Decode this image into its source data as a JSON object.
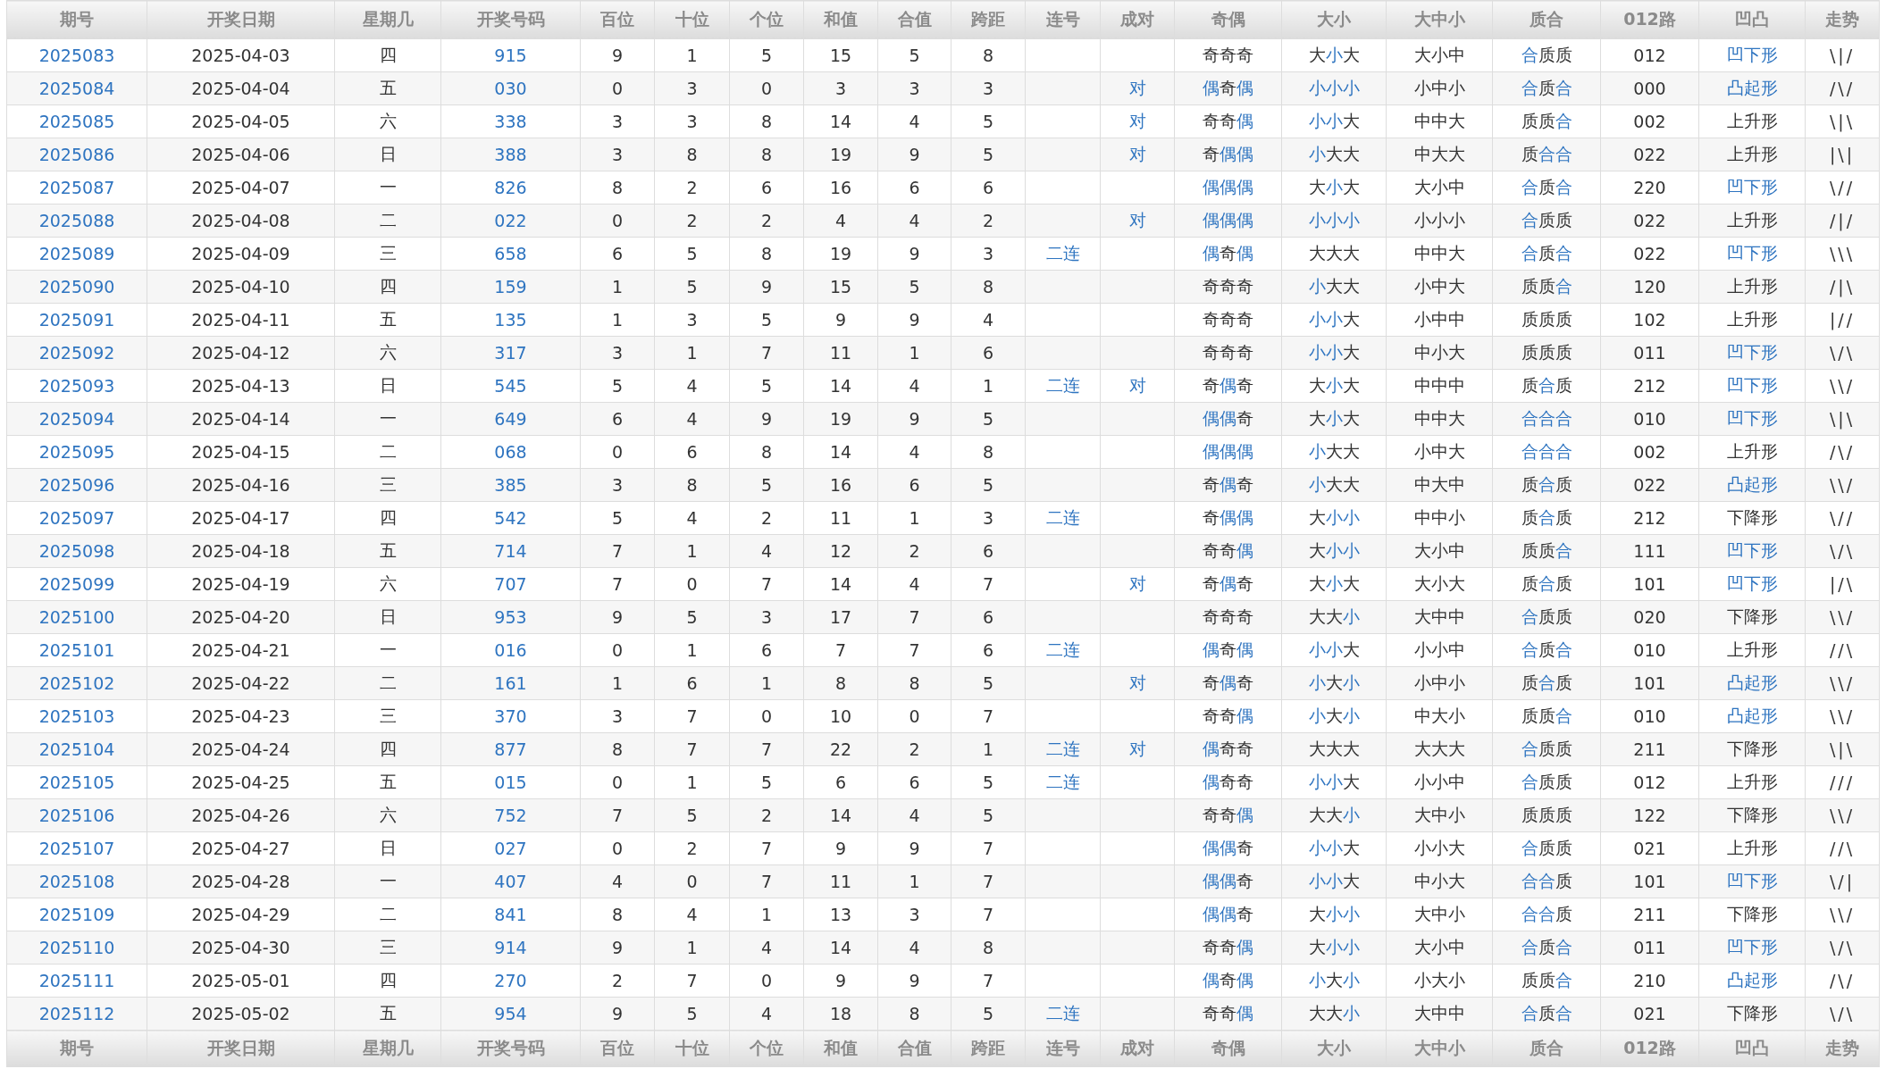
{
  "table": {
    "columns": [
      "期号",
      "开奖日期",
      "星期几",
      "开奖号码",
      "百位",
      "十位",
      "个位",
      "和值",
      "合值",
      "跨距",
      "连号",
      "成对",
      "奇偶",
      "大小",
      "大中小",
      "质合",
      "012路",
      "凹凸",
      "走势"
    ],
    "rows": [
      {
        "period": "2025083",
        "date": "2025-04-03",
        "weekday": "四",
        "number": "915",
        "hundreds": "9",
        "tens": "1",
        "units": "5",
        "sum": "15",
        "sum_tail": "5",
        "span": "8",
        "odd_even": [
          [
            "奇",
            false
          ],
          [
            "奇",
            false
          ],
          [
            "奇",
            false
          ]
        ],
        "big_small": [
          [
            "大",
            false
          ],
          [
            "小",
            true
          ],
          [
            "大",
            false
          ]
        ],
        "big_mid_small": "大小中",
        "prime_composite": [
          [
            "合",
            true
          ],
          [
            "质",
            false
          ],
          [
            "质",
            false
          ]
        ],
        "route_012": "012",
        "shape": {
          "text": "凹下形",
          "highlight": true
        },
        "trend": "\\|/"
      },
      {
        "period": "2025084",
        "date": "2025-04-04",
        "weekday": "五",
        "number": "030",
        "hundreds": "0",
        "tens": "3",
        "units": "0",
        "sum": "3",
        "sum_tail": "3",
        "span": "3",
        "pair": "对",
        "odd_even": [
          [
            "偶",
            true
          ],
          [
            "奇",
            false
          ],
          [
            "偶",
            true
          ]
        ],
        "big_small": [
          [
            "小",
            true
          ],
          [
            "小",
            true
          ],
          [
            "小",
            true
          ]
        ],
        "big_mid_small": "小中小",
        "prime_composite": [
          [
            "合",
            true
          ],
          [
            "质",
            false
          ],
          [
            "合",
            true
          ]
        ],
        "route_012": "000",
        "shape": {
          "text": "凸起形",
          "highlight": true
        },
        "trend": "/\\/"
      },
      {
        "period": "2025085",
        "date": "2025-04-05",
        "weekday": "六",
        "number": "338",
        "hundreds": "3",
        "tens": "3",
        "units": "8",
        "sum": "14",
        "sum_tail": "4",
        "span": "5",
        "pair": "对",
        "odd_even": [
          [
            "奇",
            false
          ],
          [
            "奇",
            false
          ],
          [
            "偶",
            true
          ]
        ],
        "big_small": [
          [
            "小",
            true
          ],
          [
            "小",
            true
          ],
          [
            "大",
            false
          ]
        ],
        "big_mid_small": "中中大",
        "prime_composite": [
          [
            "质",
            false
          ],
          [
            "质",
            false
          ],
          [
            "合",
            true
          ]
        ],
        "route_012": "002",
        "shape": {
          "text": "上升形",
          "highlight": false
        },
        "trend": "\\|\\"
      },
      {
        "period": "2025086",
        "date": "2025-04-06",
        "weekday": "日",
        "number": "388",
        "hundreds": "3",
        "tens": "8",
        "units": "8",
        "sum": "19",
        "sum_tail": "9",
        "span": "5",
        "pair": "对",
        "odd_even": [
          [
            "奇",
            false
          ],
          [
            "偶",
            true
          ],
          [
            "偶",
            true
          ]
        ],
        "big_small": [
          [
            "小",
            true
          ],
          [
            "大",
            false
          ],
          [
            "大",
            false
          ]
        ],
        "big_mid_small": "中大大",
        "prime_composite": [
          [
            "质",
            false
          ],
          [
            "合",
            true
          ],
          [
            "合",
            true
          ]
        ],
        "route_012": "022",
        "shape": {
          "text": "上升形",
          "highlight": false
        },
        "trend": "|\\|"
      },
      {
        "period": "2025087",
        "date": "2025-04-07",
        "weekday": "一",
        "number": "826",
        "hundreds": "8",
        "tens": "2",
        "units": "6",
        "sum": "16",
        "sum_tail": "6",
        "span": "6",
        "odd_even": [
          [
            "偶",
            true
          ],
          [
            "偶",
            true
          ],
          [
            "偶",
            true
          ]
        ],
        "big_small": [
          [
            "大",
            false
          ],
          [
            "小",
            true
          ],
          [
            "大",
            false
          ]
        ],
        "big_mid_small": "大小中",
        "prime_composite": [
          [
            "合",
            true
          ],
          [
            "质",
            false
          ],
          [
            "合",
            true
          ]
        ],
        "route_012": "220",
        "shape": {
          "text": "凹下形",
          "highlight": true
        },
        "trend": "\\//"
      },
      {
        "period": "2025088",
        "date": "2025-04-08",
        "weekday": "二",
        "number": "022",
        "hundreds": "0",
        "tens": "2",
        "units": "2",
        "sum": "4",
        "sum_tail": "4",
        "span": "2",
        "pair": "对",
        "odd_even": [
          [
            "偶",
            true
          ],
          [
            "偶",
            true
          ],
          [
            "偶",
            true
          ]
        ],
        "big_small": [
          [
            "小",
            true
          ],
          [
            "小",
            true
          ],
          [
            "小",
            true
          ]
        ],
        "big_mid_small": "小小小",
        "prime_composite": [
          [
            "合",
            true
          ],
          [
            "质",
            false
          ],
          [
            "质",
            false
          ]
        ],
        "route_012": "022",
        "shape": {
          "text": "上升形",
          "highlight": false
        },
        "trend": "/|/"
      },
      {
        "period": "2025089",
        "date": "2025-04-09",
        "weekday": "三",
        "number": "658",
        "hundreds": "6",
        "tens": "5",
        "units": "8",
        "sum": "19",
        "sum_tail": "9",
        "span": "3",
        "consecutive": "二连",
        "odd_even": [
          [
            "偶",
            true
          ],
          [
            "奇",
            false
          ],
          [
            "偶",
            true
          ]
        ],
        "big_small": [
          [
            "大",
            false
          ],
          [
            "大",
            false
          ],
          [
            "大",
            false
          ]
        ],
        "big_mid_small": "中中大",
        "prime_composite": [
          [
            "合",
            true
          ],
          [
            "质",
            false
          ],
          [
            "合",
            true
          ]
        ],
        "route_012": "022",
        "shape": {
          "text": "凹下形",
          "highlight": true
        },
        "trend": "\\\\\\"
      },
      {
        "period": "2025090",
        "date": "2025-04-10",
        "weekday": "四",
        "number": "159",
        "hundreds": "1",
        "tens": "5",
        "units": "9",
        "sum": "15",
        "sum_tail": "5",
        "span": "8",
        "odd_even": [
          [
            "奇",
            false
          ],
          [
            "奇",
            false
          ],
          [
            "奇",
            false
          ]
        ],
        "big_small": [
          [
            "小",
            true
          ],
          [
            "大",
            false
          ],
          [
            "大",
            false
          ]
        ],
        "big_mid_small": "小中大",
        "prime_composite": [
          [
            "质",
            false
          ],
          [
            "质",
            false
          ],
          [
            "合",
            true
          ]
        ],
        "route_012": "120",
        "shape": {
          "text": "上升形",
          "highlight": false
        },
        "trend": "/|\\"
      },
      {
        "period": "2025091",
        "date": "2025-04-11",
        "weekday": "五",
        "number": "135",
        "hundreds": "1",
        "tens": "3",
        "units": "5",
        "sum": "9",
        "sum_tail": "9",
        "span": "4",
        "odd_even": [
          [
            "奇",
            false
          ],
          [
            "奇",
            false
          ],
          [
            "奇",
            false
          ]
        ],
        "big_small": [
          [
            "小",
            true
          ],
          [
            "小",
            true
          ],
          [
            "大",
            false
          ]
        ],
        "big_mid_small": "小中中",
        "prime_composite": [
          [
            "质",
            false
          ],
          [
            "质",
            false
          ],
          [
            "质",
            false
          ]
        ],
        "route_012": "102",
        "shape": {
          "text": "上升形",
          "highlight": false
        },
        "trend": "|//"
      },
      {
        "period": "2025092",
        "date": "2025-04-12",
        "weekday": "六",
        "number": "317",
        "hundreds": "3",
        "tens": "1",
        "units": "7",
        "sum": "11",
        "sum_tail": "1",
        "span": "6",
        "odd_even": [
          [
            "奇",
            false
          ],
          [
            "奇",
            false
          ],
          [
            "奇",
            false
          ]
        ],
        "big_small": [
          [
            "小",
            true
          ],
          [
            "小",
            true
          ],
          [
            "大",
            false
          ]
        ],
        "big_mid_small": "中小大",
        "prime_composite": [
          [
            "质",
            false
          ],
          [
            "质",
            false
          ],
          [
            "质",
            false
          ]
        ],
        "route_012": "011",
        "shape": {
          "text": "凹下形",
          "highlight": true
        },
        "trend": "\\/\\"
      },
      {
        "period": "2025093",
        "date": "2025-04-13",
        "weekday": "日",
        "number": "545",
        "hundreds": "5",
        "tens": "4",
        "units": "5",
        "sum": "14",
        "sum_tail": "4",
        "span": "1",
        "consecutive": "二连",
        "pair": "对",
        "odd_even": [
          [
            "奇",
            false
          ],
          [
            "偶",
            true
          ],
          [
            "奇",
            false
          ]
        ],
        "big_small": [
          [
            "大",
            false
          ],
          [
            "小",
            true
          ],
          [
            "大",
            false
          ]
        ],
        "big_mid_small": "中中中",
        "prime_composite": [
          [
            "质",
            false
          ],
          [
            "合",
            true
          ],
          [
            "质",
            false
          ]
        ],
        "route_012": "212",
        "shape": {
          "text": "凹下形",
          "highlight": true
        },
        "trend": "\\\\/"
      },
      {
        "period": "2025094",
        "date": "2025-04-14",
        "weekday": "一",
        "number": "649",
        "hundreds": "6",
        "tens": "4",
        "units": "9",
        "sum": "19",
        "sum_tail": "9",
        "span": "5",
        "odd_even": [
          [
            "偶",
            true
          ],
          [
            "偶",
            true
          ],
          [
            "奇",
            false
          ]
        ],
        "big_small": [
          [
            "大",
            false
          ],
          [
            "小",
            true
          ],
          [
            "大",
            false
          ]
        ],
        "big_mid_small": "中中大",
        "prime_composite": [
          [
            "合",
            true
          ],
          [
            "合",
            true
          ],
          [
            "合",
            true
          ]
        ],
        "route_012": "010",
        "shape": {
          "text": "凹下形",
          "highlight": true
        },
        "trend": "\\|\\"
      },
      {
        "period": "2025095",
        "date": "2025-04-15",
        "weekday": "二",
        "number": "068",
        "hundreds": "0",
        "tens": "6",
        "units": "8",
        "sum": "14",
        "sum_tail": "4",
        "span": "8",
        "odd_even": [
          [
            "偶",
            true
          ],
          [
            "偶",
            true
          ],
          [
            "偶",
            true
          ]
        ],
        "big_small": [
          [
            "小",
            true
          ],
          [
            "大",
            false
          ],
          [
            "大",
            false
          ]
        ],
        "big_mid_small": "小中大",
        "prime_composite": [
          [
            "合",
            true
          ],
          [
            "合",
            true
          ],
          [
            "合",
            true
          ]
        ],
        "route_012": "002",
        "shape": {
          "text": "上升形",
          "highlight": false
        },
        "trend": "/\\/"
      },
      {
        "period": "2025096",
        "date": "2025-04-16",
        "weekday": "三",
        "number": "385",
        "hundreds": "3",
        "tens": "8",
        "units": "5",
        "sum": "16",
        "sum_tail": "6",
        "span": "5",
        "odd_even": [
          [
            "奇",
            false
          ],
          [
            "偶",
            true
          ],
          [
            "奇",
            false
          ]
        ],
        "big_small": [
          [
            "小",
            true
          ],
          [
            "大",
            false
          ],
          [
            "大",
            false
          ]
        ],
        "big_mid_small": "中大中",
        "prime_composite": [
          [
            "质",
            false
          ],
          [
            "合",
            true
          ],
          [
            "质",
            false
          ]
        ],
        "route_012": "022",
        "shape": {
          "text": "凸起形",
          "highlight": true
        },
        "trend": "\\\\/"
      },
      {
        "period": "2025097",
        "date": "2025-04-17",
        "weekday": "四",
        "number": "542",
        "hundreds": "5",
        "tens": "4",
        "units": "2",
        "sum": "11",
        "sum_tail": "1",
        "span": "3",
        "consecutive": "二连",
        "odd_even": [
          [
            "奇",
            false
          ],
          [
            "偶",
            true
          ],
          [
            "偶",
            true
          ]
        ],
        "big_small": [
          [
            "大",
            false
          ],
          [
            "小",
            true
          ],
          [
            "小",
            true
          ]
        ],
        "big_mid_small": "中中小",
        "prime_composite": [
          [
            "质",
            false
          ],
          [
            "合",
            true
          ],
          [
            "质",
            false
          ]
        ],
        "route_012": "212",
        "shape": {
          "text": "下降形",
          "highlight": false
        },
        "trend": "\\//"
      },
      {
        "period": "2025098",
        "date": "2025-04-18",
        "weekday": "五",
        "number": "714",
        "hundreds": "7",
        "tens": "1",
        "units": "4",
        "sum": "12",
        "sum_tail": "2",
        "span": "6",
        "odd_even": [
          [
            "奇",
            false
          ],
          [
            "奇",
            false
          ],
          [
            "偶",
            true
          ]
        ],
        "big_small": [
          [
            "大",
            false
          ],
          [
            "小",
            true
          ],
          [
            "小",
            true
          ]
        ],
        "big_mid_small": "大小中",
        "prime_composite": [
          [
            "质",
            false
          ],
          [
            "质",
            false
          ],
          [
            "合",
            true
          ]
        ],
        "route_012": "111",
        "shape": {
          "text": "凹下形",
          "highlight": true
        },
        "trend": "\\/\\"
      },
      {
        "period": "2025099",
        "date": "2025-04-19",
        "weekday": "六",
        "number": "707",
        "hundreds": "7",
        "tens": "0",
        "units": "7",
        "sum": "14",
        "sum_tail": "4",
        "span": "7",
        "pair": "对",
        "odd_even": [
          [
            "奇",
            false
          ],
          [
            "偶",
            true
          ],
          [
            "奇",
            false
          ]
        ],
        "big_small": [
          [
            "大",
            false
          ],
          [
            "小",
            true
          ],
          [
            "大",
            false
          ]
        ],
        "big_mid_small": "大小大",
        "prime_composite": [
          [
            "质",
            false
          ],
          [
            "合",
            true
          ],
          [
            "质",
            false
          ]
        ],
        "route_012": "101",
        "shape": {
          "text": "凹下形",
          "highlight": true
        },
        "trend": "|/\\"
      },
      {
        "period": "2025100",
        "date": "2025-04-20",
        "weekday": "日",
        "number": "953",
        "hundreds": "9",
        "tens": "5",
        "units": "3",
        "sum": "17",
        "sum_tail": "7",
        "span": "6",
        "odd_even": [
          [
            "奇",
            false
          ],
          [
            "奇",
            false
          ],
          [
            "奇",
            false
          ]
        ],
        "big_small": [
          [
            "大",
            false
          ],
          [
            "大",
            false
          ],
          [
            "小",
            true
          ]
        ],
        "big_mid_small": "大中中",
        "prime_composite": [
          [
            "合",
            true
          ],
          [
            "质",
            false
          ],
          [
            "质",
            false
          ]
        ],
        "route_012": "020",
        "shape": {
          "text": "下降形",
          "highlight": false
        },
        "trend": "\\\\/"
      },
      {
        "period": "2025101",
        "date": "2025-04-21",
        "weekday": "一",
        "number": "016",
        "hundreds": "0",
        "tens": "1",
        "units": "6",
        "sum": "7",
        "sum_tail": "7",
        "span": "6",
        "consecutive": "二连",
        "odd_even": [
          [
            "偶",
            true
          ],
          [
            "奇",
            false
          ],
          [
            "偶",
            true
          ]
        ],
        "big_small": [
          [
            "小",
            true
          ],
          [
            "小",
            true
          ],
          [
            "大",
            false
          ]
        ],
        "big_mid_small": "小小中",
        "prime_composite": [
          [
            "合",
            true
          ],
          [
            "质",
            false
          ],
          [
            "合",
            true
          ]
        ],
        "route_012": "010",
        "shape": {
          "text": "上升形",
          "highlight": false
        },
        "trend": "//\\"
      },
      {
        "period": "2025102",
        "date": "2025-04-22",
        "weekday": "二",
        "number": "161",
        "hundreds": "1",
        "tens": "6",
        "units": "1",
        "sum": "8",
        "sum_tail": "8",
        "span": "5",
        "pair": "对",
        "odd_even": [
          [
            "奇",
            false
          ],
          [
            "偶",
            true
          ],
          [
            "奇",
            false
          ]
        ],
        "big_small": [
          [
            "小",
            true
          ],
          [
            "大",
            false
          ],
          [
            "小",
            true
          ]
        ],
        "big_mid_small": "小中小",
        "prime_composite": [
          [
            "质",
            false
          ],
          [
            "合",
            true
          ],
          [
            "质",
            false
          ]
        ],
        "route_012": "101",
        "shape": {
          "text": "凸起形",
          "highlight": true
        },
        "trend": "\\\\/"
      },
      {
        "period": "2025103",
        "date": "2025-04-23",
        "weekday": "三",
        "number": "370",
        "hundreds": "3",
        "tens": "7",
        "units": "0",
        "sum": "10",
        "sum_tail": "0",
        "span": "7",
        "odd_even": [
          [
            "奇",
            false
          ],
          [
            "奇",
            false
          ],
          [
            "偶",
            true
          ]
        ],
        "big_small": [
          [
            "小",
            true
          ],
          [
            "大",
            false
          ],
          [
            "小",
            true
          ]
        ],
        "big_mid_small": "中大小",
        "prime_composite": [
          [
            "质",
            false
          ],
          [
            "质",
            false
          ],
          [
            "合",
            true
          ]
        ],
        "route_012": "010",
        "shape": {
          "text": "凸起形",
          "highlight": true
        },
        "trend": "\\\\/"
      },
      {
        "period": "2025104",
        "date": "2025-04-24",
        "weekday": "四",
        "number": "877",
        "hundreds": "8",
        "tens": "7",
        "units": "7",
        "sum": "22",
        "sum_tail": "2",
        "span": "1",
        "consecutive": "二连",
        "pair": "对",
        "odd_even": [
          [
            "偶",
            true
          ],
          [
            "奇",
            false
          ],
          [
            "奇",
            false
          ]
        ],
        "big_small": [
          [
            "大",
            false
          ],
          [
            "大",
            false
          ],
          [
            "大",
            false
          ]
        ],
        "big_mid_small": "大大大",
        "prime_composite": [
          [
            "合",
            true
          ],
          [
            "质",
            false
          ],
          [
            "质",
            false
          ]
        ],
        "route_012": "211",
        "shape": {
          "text": "下降形",
          "highlight": false
        },
        "trend": "\\|\\"
      },
      {
        "period": "2025105",
        "date": "2025-04-25",
        "weekday": "五",
        "number": "015",
        "hundreds": "0",
        "tens": "1",
        "units": "5",
        "sum": "6",
        "sum_tail": "6",
        "span": "5",
        "consecutive": "二连",
        "odd_even": [
          [
            "偶",
            true
          ],
          [
            "奇",
            false
          ],
          [
            "奇",
            false
          ]
        ],
        "big_small": [
          [
            "小",
            true
          ],
          [
            "小",
            true
          ],
          [
            "大",
            false
          ]
        ],
        "big_mid_small": "小小中",
        "prime_composite": [
          [
            "合",
            true
          ],
          [
            "质",
            false
          ],
          [
            "质",
            false
          ]
        ],
        "route_012": "012",
        "shape": {
          "text": "上升形",
          "highlight": false
        },
        "trend": "///"
      },
      {
        "period": "2025106",
        "date": "2025-04-26",
        "weekday": "六",
        "number": "752",
        "hundreds": "7",
        "tens": "5",
        "units": "2",
        "sum": "14",
        "sum_tail": "4",
        "span": "5",
        "odd_even": [
          [
            "奇",
            false
          ],
          [
            "奇",
            false
          ],
          [
            "偶",
            true
          ]
        ],
        "big_small": [
          [
            "大",
            false
          ],
          [
            "大",
            false
          ],
          [
            "小",
            true
          ]
        ],
        "big_mid_small": "大中小",
        "prime_composite": [
          [
            "质",
            false
          ],
          [
            "质",
            false
          ],
          [
            "质",
            false
          ]
        ],
        "route_012": "122",
        "shape": {
          "text": "下降形",
          "highlight": false
        },
        "trend": "\\\\/"
      },
      {
        "period": "2025107",
        "date": "2025-04-27",
        "weekday": "日",
        "number": "027",
        "hundreds": "0",
        "tens": "2",
        "units": "7",
        "sum": "9",
        "sum_tail": "9",
        "span": "7",
        "odd_even": [
          [
            "偶",
            true
          ],
          [
            "偶",
            true
          ],
          [
            "奇",
            false
          ]
        ],
        "big_small": [
          [
            "小",
            true
          ],
          [
            "小",
            true
          ],
          [
            "大",
            false
          ]
        ],
        "big_mid_small": "小小大",
        "prime_composite": [
          [
            "合",
            true
          ],
          [
            "质",
            false
          ],
          [
            "质",
            false
          ]
        ],
        "route_012": "021",
        "shape": {
          "text": "上升形",
          "highlight": false
        },
        "trend": "//\\"
      },
      {
        "period": "2025108",
        "date": "2025-04-28",
        "weekday": "一",
        "number": "407",
        "hundreds": "4",
        "tens": "0",
        "units": "7",
        "sum": "11",
        "sum_tail": "1",
        "span": "7",
        "odd_even": [
          [
            "偶",
            true
          ],
          [
            "偶",
            true
          ],
          [
            "奇",
            false
          ]
        ],
        "big_small": [
          [
            "小",
            true
          ],
          [
            "小",
            true
          ],
          [
            "大",
            false
          ]
        ],
        "big_mid_small": "中小大",
        "prime_composite": [
          [
            "合",
            true
          ],
          [
            "合",
            true
          ],
          [
            "质",
            false
          ]
        ],
        "route_012": "101",
        "shape": {
          "text": "凹下形",
          "highlight": true
        },
        "trend": "\\/|"
      },
      {
        "period": "2025109",
        "date": "2025-04-29",
        "weekday": "二",
        "number": "841",
        "hundreds": "8",
        "tens": "4",
        "units": "1",
        "sum": "13",
        "sum_tail": "3",
        "span": "7",
        "odd_even": [
          [
            "偶",
            true
          ],
          [
            "偶",
            true
          ],
          [
            "奇",
            false
          ]
        ],
        "big_small": [
          [
            "大",
            false
          ],
          [
            "小",
            true
          ],
          [
            "小",
            true
          ]
        ],
        "big_mid_small": "大中小",
        "prime_composite": [
          [
            "合",
            true
          ],
          [
            "合",
            true
          ],
          [
            "质",
            false
          ]
        ],
        "route_012": "211",
        "shape": {
          "text": "下降形",
          "highlight": false
        },
        "trend": "\\\\/"
      },
      {
        "period": "2025110",
        "date": "2025-04-30",
        "weekday": "三",
        "number": "914",
        "hundreds": "9",
        "tens": "1",
        "units": "4",
        "sum": "14",
        "sum_tail": "4",
        "span": "8",
        "odd_even": [
          [
            "奇",
            false
          ],
          [
            "奇",
            false
          ],
          [
            "偶",
            true
          ]
        ],
        "big_small": [
          [
            "大",
            false
          ],
          [
            "小",
            true
          ],
          [
            "小",
            true
          ]
        ],
        "big_mid_small": "大小中",
        "prime_composite": [
          [
            "合",
            true
          ],
          [
            "质",
            false
          ],
          [
            "合",
            true
          ]
        ],
        "route_012": "011",
        "shape": {
          "text": "凹下形",
          "highlight": true
        },
        "trend": "\\/\\"
      },
      {
        "period": "2025111",
        "date": "2025-05-01",
        "weekday": "四",
        "number": "270",
        "hundreds": "2",
        "tens": "7",
        "units": "0",
        "sum": "9",
        "sum_tail": "9",
        "span": "7",
        "odd_even": [
          [
            "偶",
            true
          ],
          [
            "奇",
            false
          ],
          [
            "偶",
            true
          ]
        ],
        "big_small": [
          [
            "小",
            true
          ],
          [
            "大",
            false
          ],
          [
            "小",
            true
          ]
        ],
        "big_mid_small": "小大小",
        "prime_composite": [
          [
            "质",
            false
          ],
          [
            "质",
            false
          ],
          [
            "合",
            true
          ]
        ],
        "route_012": "210",
        "shape": {
          "text": "凸起形",
          "highlight": true
        },
        "trend": "/\\/"
      },
      {
        "period": "2025112",
        "date": "2025-05-02",
        "weekday": "五",
        "number": "954",
        "hundreds": "9",
        "tens": "5",
        "units": "4",
        "sum": "18",
        "sum_tail": "8",
        "span": "5",
        "consecutive": "二连",
        "odd_even": [
          [
            "奇",
            false
          ],
          [
            "奇",
            false
          ],
          [
            "偶",
            true
          ]
        ],
        "big_small": [
          [
            "大",
            false
          ],
          [
            "大",
            false
          ],
          [
            "小",
            true
          ]
        ],
        "big_mid_small": "大中中",
        "prime_composite": [
          [
            "合",
            true
          ],
          [
            "质",
            false
          ],
          [
            "合",
            true
          ]
        ],
        "route_012": "021",
        "shape": {
          "text": "下降形",
          "highlight": false
        },
        "trend": "\\/\\"
      }
    ],
    "footer_columns": [
      "期号",
      "开奖日期",
      "星期几",
      "开奖号码",
      "百位",
      "十位",
      "个位",
      "和值",
      "合值",
      "跨距",
      "连号",
      "成对",
      "奇偶",
      "大小",
      "大中小",
      "质合",
      "012路",
      "凹凸",
      "走势"
    ]
  }
}
